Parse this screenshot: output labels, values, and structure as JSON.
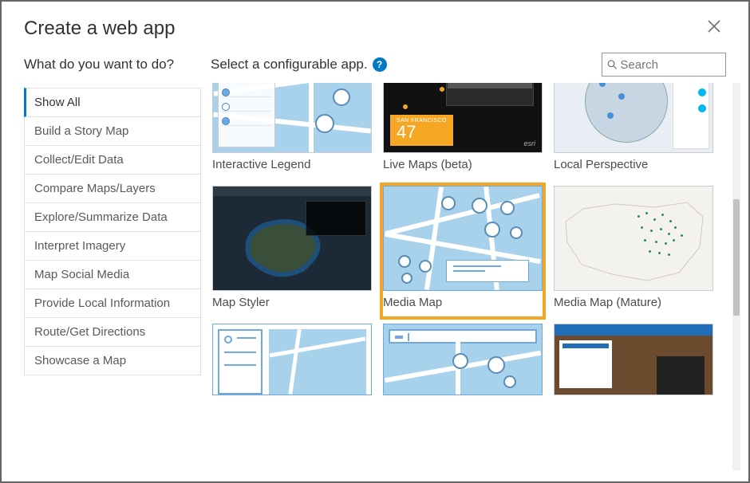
{
  "header": {
    "title": "Create a web app",
    "close_aria": "Close"
  },
  "subheader": {
    "question": "What do you want to do?",
    "prompt": "Select a configurable app.",
    "help_glyph": "?",
    "search_placeholder": "Search"
  },
  "sidebar": {
    "items": [
      "Show All",
      "Build a Story Map",
      "Collect/Edit Data",
      "Compare Maps/Layers",
      "Explore/Summarize Data",
      "Interpret Imagery",
      "Map Social Media",
      "Provide Local Information",
      "Route/Get Directions",
      "Showcase a Map"
    ],
    "active_index": 0
  },
  "gallery": {
    "cards_row1": [
      {
        "label": "Interactive Legend"
      },
      {
        "label": "Live Maps (beta)"
      },
      {
        "label": "Local Perspective"
      }
    ],
    "cards_row2": [
      {
        "label": "Map Styler"
      },
      {
        "label": "Media Map"
      },
      {
        "label": "Media Map (Mature)"
      }
    ],
    "selected_label": "Media Map"
  },
  "scroll": {
    "top_pct": 30,
    "height_pct": 30
  },
  "colors": {
    "accent": "#007ac2",
    "highlight": "#f5a623"
  },
  "live_badge": {
    "city": "SAN FRANCISCO",
    "value": "47"
  }
}
